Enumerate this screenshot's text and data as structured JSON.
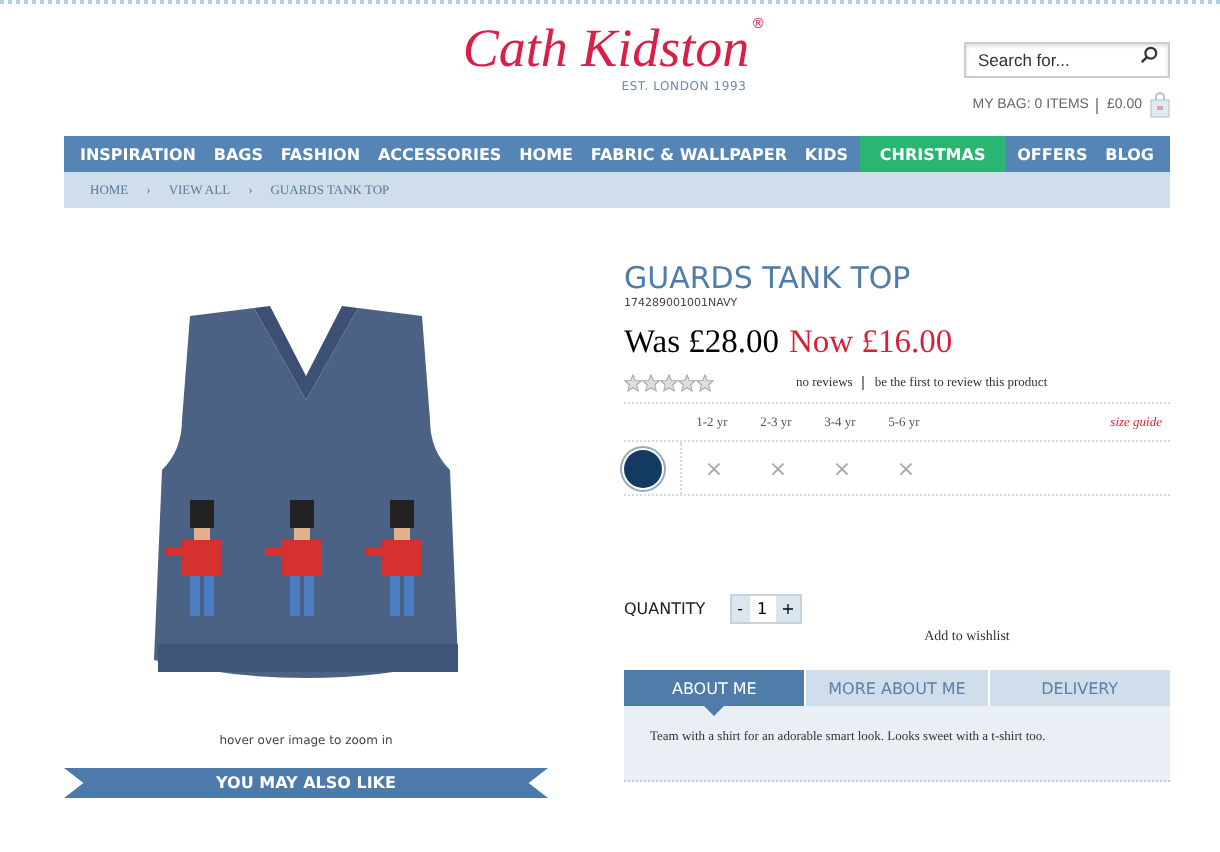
{
  "header": {
    "logo": "Cath Kidston",
    "logo_mark": "®",
    "tagline": "EST. LONDON 1993",
    "search": {
      "placeholder": "Search for..."
    },
    "bag": "MY BAG: 0 ITEMS",
    "bag_total": "£0.00"
  },
  "nav": [
    {
      "label": "INSPIRATION",
      "highlighted": false
    },
    {
      "label": "BAGS",
      "highlighted": false
    },
    {
      "label": "FASHION",
      "highlighted": false
    },
    {
      "label": "ACCESSORIES",
      "highlighted": false
    },
    {
      "label": "HOME",
      "highlighted": false
    },
    {
      "label": "FABRIC & WALLPAPER",
      "highlighted": false
    },
    {
      "label": "KIDS",
      "highlighted": false
    },
    {
      "label": "CHRISTMAS",
      "highlighted": true
    },
    {
      "label": "OFFERS",
      "highlighted": false
    },
    {
      "label": "BLOG",
      "highlighted": false
    }
  ],
  "breadcrumb": [
    "HOME",
    "VIEW ALL",
    "GUARDS TANK TOP"
  ],
  "breadcrumb_separator": "›",
  "image": {
    "caption": "hover over image to zoom in"
  },
  "also_like": "YOU MAY ALSO LIKE",
  "product": {
    "title": "GUARDS TANK TOP",
    "sku": "174289001001NAVY",
    "was": "Was £28.00",
    "now": "Now £16.00",
    "stars": 0,
    "reviews": "no reviews",
    "review_link": "be the first to review this product",
    "sizes": [
      {
        "label": "1-2 yr",
        "available": false
      },
      {
        "label": "2-3 yr",
        "available": false
      },
      {
        "label": "3-4 yr",
        "available": false
      },
      {
        "label": "5-6 yr",
        "available": false
      }
    ],
    "size_guide": "size guide",
    "unavailable_mark": "×",
    "colors": [
      {
        "color": "#123a63",
        "selected": true
      }
    ],
    "quantity_label": "QUANTITY",
    "minus": "-",
    "quantity": "1",
    "plus": "+",
    "wishlist": "Add to wishlist",
    "tabs": [
      {
        "label": "ABOUT ME",
        "selected": true
      },
      {
        "label": "MORE ABOUT ME",
        "selected": false
      },
      {
        "label": "DELIVERY",
        "selected": false
      }
    ],
    "description": "Team with a shirt for an adorable smart look. Looks sweet with a t-shirt too."
  }
}
